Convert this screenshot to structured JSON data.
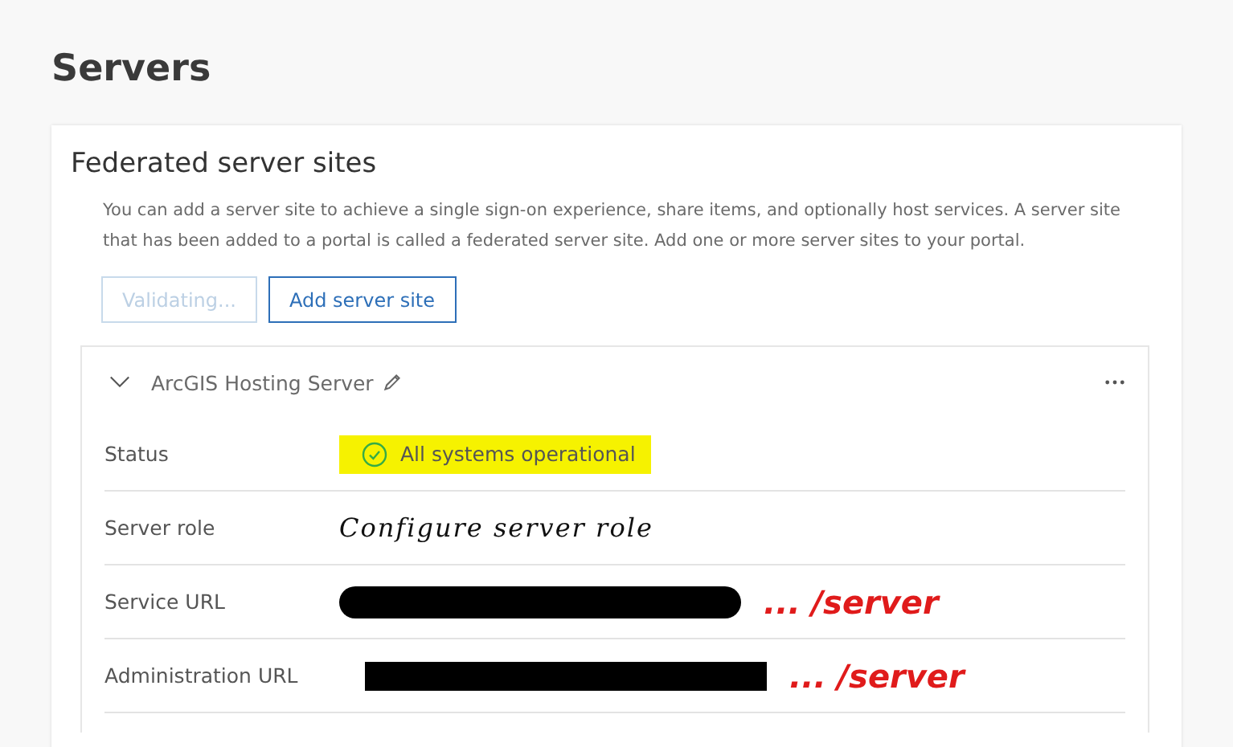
{
  "page": {
    "title": "Servers"
  },
  "card": {
    "title": "Federated server sites",
    "description": "You can add a server site to achieve a single sign-on experience, share items, and optionally host services. A server site that has been added to a portal is called a federated server site. Add one or more server sites to your portal.",
    "buttons": [
      {
        "label": "Validating...",
        "disabled": true
      },
      {
        "label": "Add server site",
        "disabled": false
      }
    ]
  },
  "server": {
    "name": "ArcGIS Hosting Server",
    "expanded": true,
    "rows": [
      {
        "label": "Status",
        "kind": "status",
        "value": "All systems operational",
        "highlighted": true
      },
      {
        "label": "Server role",
        "kind": "handwritten",
        "value": "Configure server role"
      },
      {
        "label": "Service URL",
        "kind": "scribble",
        "note": "... /server"
      },
      {
        "label": "Administration URL",
        "kind": "bar",
        "note": "... /server"
      }
    ]
  }
}
